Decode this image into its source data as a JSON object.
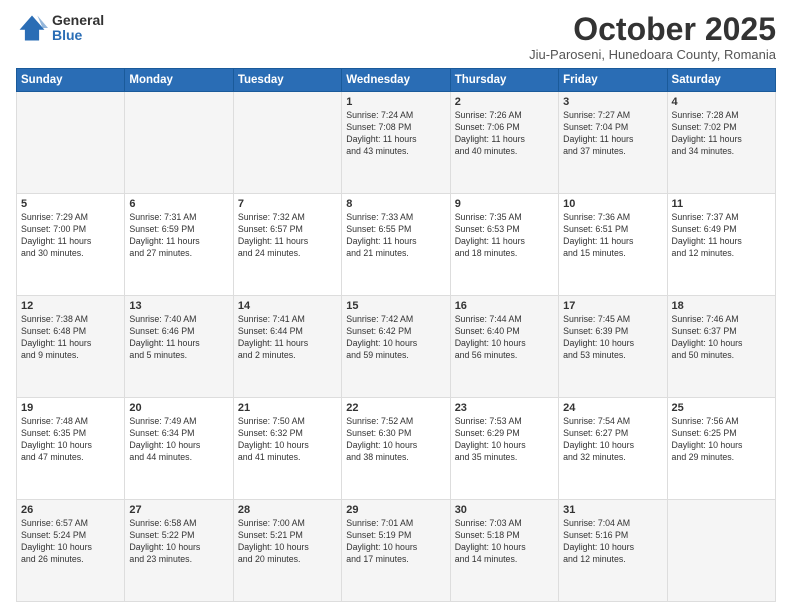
{
  "logo": {
    "general": "General",
    "blue": "Blue"
  },
  "header": {
    "month": "October 2025",
    "location": "Jiu-Paroseni, Hunedoara County, Romania"
  },
  "weekdays": [
    "Sunday",
    "Monday",
    "Tuesday",
    "Wednesday",
    "Thursday",
    "Friday",
    "Saturday"
  ],
  "weeks": [
    [
      {
        "day": "",
        "info": ""
      },
      {
        "day": "",
        "info": ""
      },
      {
        "day": "",
        "info": ""
      },
      {
        "day": "1",
        "info": "Sunrise: 7:24 AM\nSunset: 7:08 PM\nDaylight: 11 hours\nand 43 minutes."
      },
      {
        "day": "2",
        "info": "Sunrise: 7:26 AM\nSunset: 7:06 PM\nDaylight: 11 hours\nand 40 minutes."
      },
      {
        "day": "3",
        "info": "Sunrise: 7:27 AM\nSunset: 7:04 PM\nDaylight: 11 hours\nand 37 minutes."
      },
      {
        "day": "4",
        "info": "Sunrise: 7:28 AM\nSunset: 7:02 PM\nDaylight: 11 hours\nand 34 minutes."
      }
    ],
    [
      {
        "day": "5",
        "info": "Sunrise: 7:29 AM\nSunset: 7:00 PM\nDaylight: 11 hours\nand 30 minutes."
      },
      {
        "day": "6",
        "info": "Sunrise: 7:31 AM\nSunset: 6:59 PM\nDaylight: 11 hours\nand 27 minutes."
      },
      {
        "day": "7",
        "info": "Sunrise: 7:32 AM\nSunset: 6:57 PM\nDaylight: 11 hours\nand 24 minutes."
      },
      {
        "day": "8",
        "info": "Sunrise: 7:33 AM\nSunset: 6:55 PM\nDaylight: 11 hours\nand 21 minutes."
      },
      {
        "day": "9",
        "info": "Sunrise: 7:35 AM\nSunset: 6:53 PM\nDaylight: 11 hours\nand 18 minutes."
      },
      {
        "day": "10",
        "info": "Sunrise: 7:36 AM\nSunset: 6:51 PM\nDaylight: 11 hours\nand 15 minutes."
      },
      {
        "day": "11",
        "info": "Sunrise: 7:37 AM\nSunset: 6:49 PM\nDaylight: 11 hours\nand 12 minutes."
      }
    ],
    [
      {
        "day": "12",
        "info": "Sunrise: 7:38 AM\nSunset: 6:48 PM\nDaylight: 11 hours\nand 9 minutes."
      },
      {
        "day": "13",
        "info": "Sunrise: 7:40 AM\nSunset: 6:46 PM\nDaylight: 11 hours\nand 5 minutes."
      },
      {
        "day": "14",
        "info": "Sunrise: 7:41 AM\nSunset: 6:44 PM\nDaylight: 11 hours\nand 2 minutes."
      },
      {
        "day": "15",
        "info": "Sunrise: 7:42 AM\nSunset: 6:42 PM\nDaylight: 10 hours\nand 59 minutes."
      },
      {
        "day": "16",
        "info": "Sunrise: 7:44 AM\nSunset: 6:40 PM\nDaylight: 10 hours\nand 56 minutes."
      },
      {
        "day": "17",
        "info": "Sunrise: 7:45 AM\nSunset: 6:39 PM\nDaylight: 10 hours\nand 53 minutes."
      },
      {
        "day": "18",
        "info": "Sunrise: 7:46 AM\nSunset: 6:37 PM\nDaylight: 10 hours\nand 50 minutes."
      }
    ],
    [
      {
        "day": "19",
        "info": "Sunrise: 7:48 AM\nSunset: 6:35 PM\nDaylight: 10 hours\nand 47 minutes."
      },
      {
        "day": "20",
        "info": "Sunrise: 7:49 AM\nSunset: 6:34 PM\nDaylight: 10 hours\nand 44 minutes."
      },
      {
        "day": "21",
        "info": "Sunrise: 7:50 AM\nSunset: 6:32 PM\nDaylight: 10 hours\nand 41 minutes."
      },
      {
        "day": "22",
        "info": "Sunrise: 7:52 AM\nSunset: 6:30 PM\nDaylight: 10 hours\nand 38 minutes."
      },
      {
        "day": "23",
        "info": "Sunrise: 7:53 AM\nSunset: 6:29 PM\nDaylight: 10 hours\nand 35 minutes."
      },
      {
        "day": "24",
        "info": "Sunrise: 7:54 AM\nSunset: 6:27 PM\nDaylight: 10 hours\nand 32 minutes."
      },
      {
        "day": "25",
        "info": "Sunrise: 7:56 AM\nSunset: 6:25 PM\nDaylight: 10 hours\nand 29 minutes."
      }
    ],
    [
      {
        "day": "26",
        "info": "Sunrise: 6:57 AM\nSunset: 5:24 PM\nDaylight: 10 hours\nand 26 minutes."
      },
      {
        "day": "27",
        "info": "Sunrise: 6:58 AM\nSunset: 5:22 PM\nDaylight: 10 hours\nand 23 minutes."
      },
      {
        "day": "28",
        "info": "Sunrise: 7:00 AM\nSunset: 5:21 PM\nDaylight: 10 hours\nand 20 minutes."
      },
      {
        "day": "29",
        "info": "Sunrise: 7:01 AM\nSunset: 5:19 PM\nDaylight: 10 hours\nand 17 minutes."
      },
      {
        "day": "30",
        "info": "Sunrise: 7:03 AM\nSunset: 5:18 PM\nDaylight: 10 hours\nand 14 minutes."
      },
      {
        "day": "31",
        "info": "Sunrise: 7:04 AM\nSunset: 5:16 PM\nDaylight: 10 hours\nand 12 minutes."
      },
      {
        "day": "",
        "info": ""
      }
    ]
  ]
}
